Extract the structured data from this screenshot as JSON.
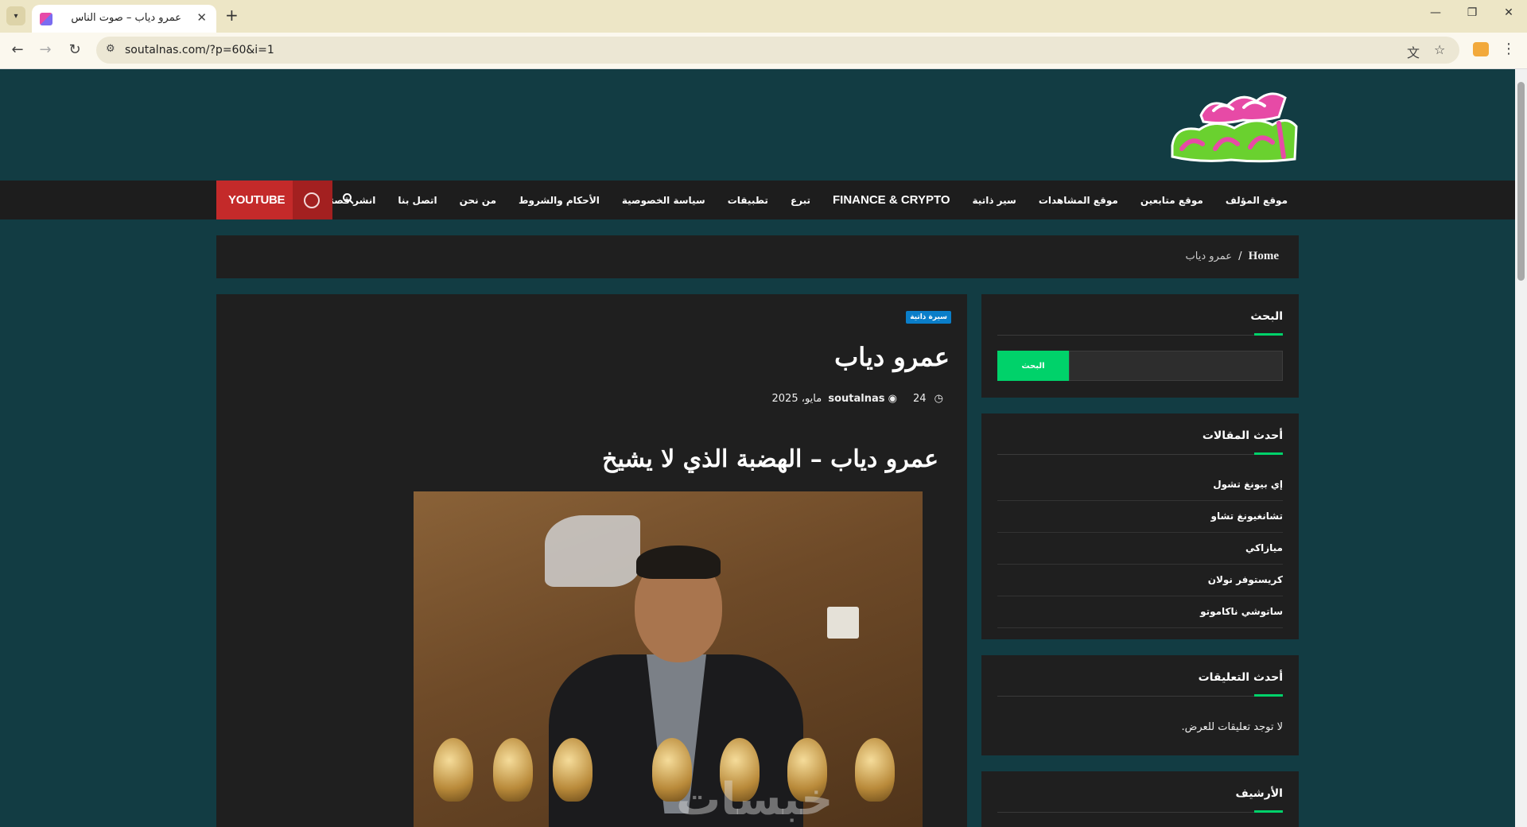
{
  "browser": {
    "tab_title": "عمرو دياب – صوت الناس",
    "url": "soutalnas.com/?p=60&i=1",
    "new_tab": "+",
    "close_tab": "✕",
    "minimize": "—",
    "restore": "❐",
    "close_window": "✕"
  },
  "nav": {
    "items": [
      {
        "label": "موقع المؤلف",
        "big": false
      },
      {
        "label": "موقع متابعين",
        "big": false
      },
      {
        "label": "موقع المشاهدات",
        "big": false
      },
      {
        "label": "سير ذاتية",
        "big": false
      },
      {
        "label": "FINANCE & CRYPTO",
        "big": true
      },
      {
        "label": "تبرع",
        "big": false
      },
      {
        "label": "تطبيقات",
        "big": false
      },
      {
        "label": "سياسة الخصوصية",
        "big": false
      },
      {
        "label": "الأحكام والشروط",
        "big": false
      },
      {
        "label": "من نحن",
        "big": false
      },
      {
        "label": "اتصل بنا",
        "big": false
      },
      {
        "label": "انشر قصتك الموقع",
        "big": false
      }
    ],
    "youtube_label": "YOUTUBE"
  },
  "breadcrumb": {
    "home": "Home",
    "separator": "/",
    "current": "عمرو دياب"
  },
  "article": {
    "category": "سيرة ذاتية",
    "title": "عمرو دياب",
    "date_day": "24",
    "date_rest": "مايو، 2025",
    "author": "soutalnas",
    "subtitle": "عمرو دياب – الهضبة الذي لا يشيخ",
    "image_watermark": "خبسات"
  },
  "sidebar": {
    "search": {
      "title": "البحث",
      "button": "البحث"
    },
    "recent_posts": {
      "title": "أحدث المقالات",
      "items": [
        "إي بيونغ تشول",
        "تشانغيونغ تشاو",
        "ميازاكي",
        "كريستوفر نولان",
        "ساتوشي ناكاموتو"
      ]
    },
    "recent_comments": {
      "title": "أحدث التعليقات",
      "empty": "لا توجد تعليقات للعرض."
    },
    "archive": {
      "title": "الأرشيف"
    }
  },
  "colors": {
    "page_bg": "#123c43",
    "card_bg": "#1f1f1f",
    "accent_green": "#00d26a",
    "youtube_red": "#c42a2a",
    "badge_blue": "#0a7ec9"
  }
}
